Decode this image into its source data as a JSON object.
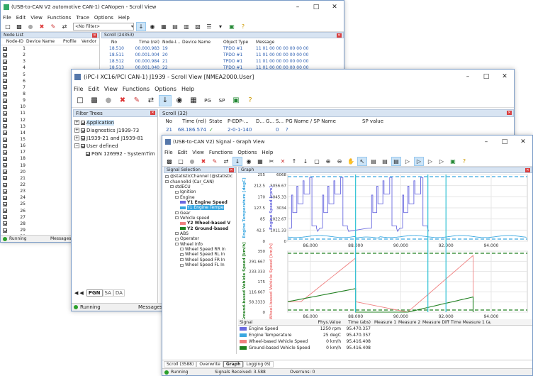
{
  "win1": {
    "title": "(USB-to-CAN V2 automotive  CAN-1) CANopen - Scroll View",
    "menu": [
      "File",
      "Edit",
      "View",
      "Functions",
      "Trace",
      "Options",
      "Help"
    ],
    "filter_value": "<No Filter>",
    "node_list": {
      "title": "Node List",
      "headers": [
        "Node-ID",
        "Device Name",
        "Profile",
        "Vendor"
      ],
      "ids": [
        "1",
        "2",
        "3",
        "4",
        "5",
        "6",
        "7",
        "8",
        "9",
        "10",
        "11",
        "12",
        "13",
        "14",
        "15",
        "16",
        "17",
        "18",
        "19",
        "20",
        "21",
        "22",
        "23",
        "24",
        "25",
        "26",
        "27",
        "28",
        "29",
        "30"
      ]
    },
    "scroll": {
      "title": "Scroll (24353)",
      "headers": [
        "No",
        "Time (rel)",
        "Node-I...",
        "Device Name",
        "Object Type",
        "Message"
      ],
      "rows": [
        [
          "18.510",
          "00.000.983",
          "19",
          "",
          "TPDO #1",
          "11 01 00 00 00 00 00 00"
        ],
        [
          "18.511",
          "00.001.004",
          "20",
          "",
          "TPDO #1",
          "11 01 00 00 00 00 00 00"
        ],
        [
          "18.512",
          "00.000.984",
          "21",
          "",
          "TPDO #1",
          "11 01 00 00 00 00 00 00"
        ],
        [
          "18.513",
          "00.001.040",
          "22",
          "",
          "TPDO #1",
          "11 01 00 00 00 00 00 00"
        ],
        [
          "18.514",
          "00.000.989",
          "23",
          "",
          "TPDO #1",
          "11 01 00 00 00 00 00 00"
        ]
      ]
    },
    "status": {
      "running": "Running",
      "messages": "Messages R"
    }
  },
  "win2": {
    "title": "(iPC-I XC16/PCI  CAN-1) J1939 - Scroll View [NMEA2000.User]",
    "menu": [
      "File",
      "Edit",
      "View",
      "Functions",
      "Options",
      "Help"
    ],
    "filter_trees": {
      "title": "Filter Trees",
      "items": [
        "Application",
        "Diagnostics  J1939-73",
        "J1939-21 and J1939-81",
        "User defined",
        "PGN 126992 - SystemTim"
      ]
    },
    "scroll": {
      "title": "Scroll (32)",
      "headers": [
        "No",
        "Time (rel)",
        "State",
        "P-EDP-...",
        "D...",
        "G...",
        "S...",
        "PG Name / SP Name",
        "SP value"
      ],
      "row": [
        "21",
        "68.186.574",
        "✓",
        "2-0-1-140",
        "",
        "",
        "0",
        "?",
        ""
      ]
    },
    "tabs": [
      "PGN",
      "SA",
      "DA"
    ],
    "status": {
      "running": "Running",
      "messages": "Messages"
    }
  },
  "win3": {
    "title": "(USB-to-CAN V2) Signal - Graph View",
    "menu": [
      "File",
      "Edit",
      "View",
      "Functions",
      "Options",
      "Help"
    ],
    "signal_selection": {
      "title": "Signal Selection",
      "tree": [
        {
          "label": "@statisticChannel  (@statistic",
          "indent": 0
        },
        {
          "label": "channelId  (Car_CAN)",
          "indent": 0
        },
        {
          "label": "stdECU",
          "indent": 1
        },
        {
          "label": "Ignition",
          "indent": 2
        },
        {
          "label": "Engine",
          "indent": 2
        },
        {
          "label": "Y1  Engine Speed",
          "indent": 3,
          "color": "#6a6ae0",
          "bold": true
        },
        {
          "label": "Y1  Engine Tempe",
          "indent": 3,
          "color": "#3aa7e0",
          "sel": true
        },
        {
          "label": "Gear",
          "indent": 2
        },
        {
          "label": "Vehicle speed",
          "indent": 2
        },
        {
          "label": "Y2  Wheel-based V",
          "indent": 3,
          "color": "#f08080",
          "bold": true
        },
        {
          "label": "Y2  Ground-based",
          "indent": 3,
          "color": "#208020",
          "bold": true
        },
        {
          "label": "ABS",
          "indent": 2
        },
        {
          "label": "Operator",
          "indent": 2
        },
        {
          "label": "Wheel info",
          "indent": 2
        },
        {
          "label": "Wheel Speed RR In",
          "indent": 3
        },
        {
          "label": "Wheel Speed RL In",
          "indent": 3
        },
        {
          "label": "Wheel Speed FR In",
          "indent": 3
        },
        {
          "label": "Wheel Speed FL In",
          "indent": 3
        }
      ]
    },
    "graph_title": "Graph",
    "top_chart": {
      "left_label": "Engine Temperature [degC]",
      "right_label": "Engine Speed [rpm]",
      "left_ticks": [
        "255",
        "212.5",
        "170",
        "127.5",
        "85",
        "42.5",
        "0"
      ],
      "right_ticks": [
        "6068",
        "5056.67",
        "4045.33",
        "3034",
        "2022.67",
        "1011.33",
        "0"
      ],
      "x_ticks": [
        "86.000",
        "88.000",
        "90.000",
        "92.000",
        "94.000"
      ]
    },
    "bottom_chart": {
      "left_label": "Ground-based Vehicle Speed [km/h]",
      "right_label": "Wheel-based Vehicle Speed [km/h]",
      "left_ticks": [
        "350",
        "291.667",
        "233.333",
        "175",
        "116.667",
        "58.3333",
        "0"
      ],
      "x_ticks": [
        "86.000",
        "88.000",
        "90.000",
        "92.000",
        "94.000"
      ]
    },
    "table": {
      "headers": [
        "Signal",
        "Phys.Value",
        "Time (abs)",
        "Measure 1",
        "Measure 2",
        "Measure Diff.",
        "Time Measure 1 (a..."
      ],
      "rows": [
        {
          "name": "Engine Speed",
          "value": "1250 rpm",
          "time": "95.470.357",
          "color": "#6a6ae0"
        },
        {
          "name": "Engine Temperature",
          "value": "25 degC",
          "time": "95.470.357",
          "color": "#3aa7e0"
        },
        {
          "name": "Wheel-based Vehicle Speed",
          "value": "0 km/h",
          "time": "95.416.408",
          "color": "#f08080"
        },
        {
          "name": "Ground-based Vehicle Speed",
          "value": "0 km/h",
          "time": "95.416.408",
          "color": "#208020"
        }
      ]
    },
    "tabs": [
      "Scroll (3588)",
      "Overwrite",
      "Graph",
      "Logging (6)"
    ],
    "status": {
      "running": "Running",
      "received": "Signals Received: 3.588",
      "overruns": "Overruns: 0"
    }
  },
  "colors": {
    "engine_speed": "#6a6ae0",
    "engine_temp": "#3aa7e0",
    "wheel_speed": "#f08080",
    "ground_speed": "#208020",
    "accent": "#0078d7"
  }
}
